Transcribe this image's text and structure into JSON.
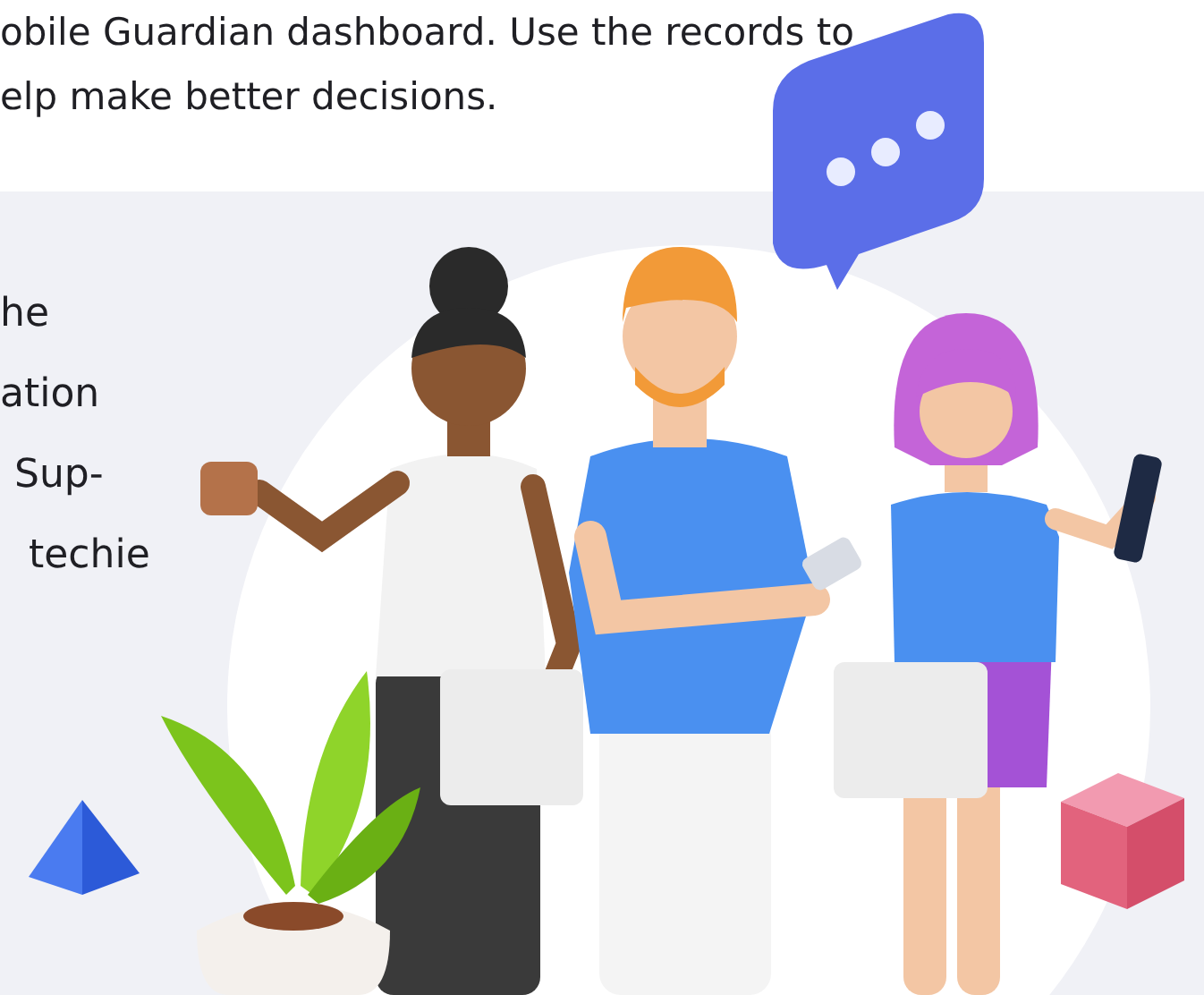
{
  "intro": {
    "lines": [
      "obile Guardian dashboard. Use the records to",
      "elp make better decisions."
    ]
  },
  "feature": {
    "lines": [
      "he",
      "ation",
      "Sup-",
      "techie"
    ]
  }
}
